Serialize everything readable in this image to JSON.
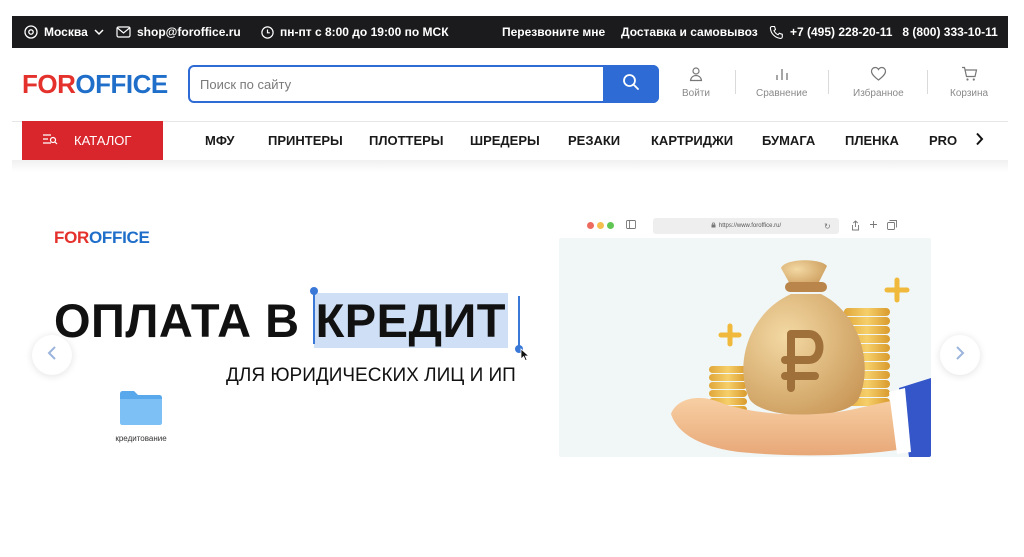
{
  "topbar": {
    "city": "Москва",
    "email": "shop@foroffice.ru",
    "hours": "пн-пт с 8:00 до 19:00 по МСК",
    "callback": "Перезвоните мне",
    "delivery": "Доставка и самовывоз",
    "phone1": "+7 (495) 228-20-11",
    "phone2": "8 (800) 333-10-11"
  },
  "logo": {
    "part1": "FOR",
    "part2": "OFFICE"
  },
  "search": {
    "placeholder": "Поиск по сайту",
    "value": ""
  },
  "header_actions": [
    {
      "label": "Войти",
      "icon": "user-icon"
    },
    {
      "label": "Сравнение",
      "icon": "compare-icon"
    },
    {
      "label": "Избранное",
      "icon": "heart-icon"
    },
    {
      "label": "Корзина",
      "icon": "cart-icon"
    }
  ],
  "nav": {
    "catalog": "КАТАЛОГ",
    "items": [
      "МФУ",
      "ПРИНТЕРЫ",
      "ПЛОТТЕРЫ",
      "ШРЕДЕРЫ",
      "РЕЗАКИ",
      "КАРТРИДЖИ",
      "БУМАГА",
      "ПЛЕНКА",
      "PRO"
    ]
  },
  "banner": {
    "logo_part1": "FOR",
    "logo_part2": "OFFICE",
    "title_plain": "ОПЛАТА В",
    "title_selected": "КРЕДИТ",
    "subtitle": "ДЛЯ ЮРИДИЧЕСКИХ ЛИЦ И ИП",
    "folder_label": "кредитование",
    "browser_url": "https://www.foroffice.ru/"
  },
  "colors": {
    "brand_red": "#e5312c",
    "brand_blue": "#1f6ec9",
    "catalog_red": "#d9262c",
    "search_blue": "#2f6bd4",
    "topbar_bg": "#1b1b1d",
    "selection": "#cfe0f6"
  }
}
